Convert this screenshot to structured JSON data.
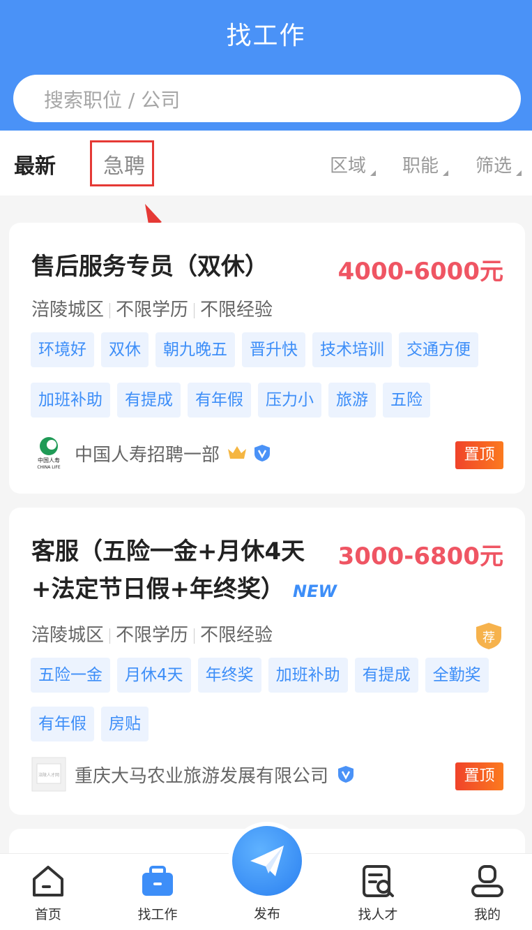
{
  "header": {
    "title": "找工作",
    "search_placeholder": "搜索职位 / 公司"
  },
  "filters": {
    "tab_latest": "最新",
    "tab_urgent": "急聘",
    "area": "区域",
    "function": "职能",
    "filter": "筛选"
  },
  "jobs": [
    {
      "title": "售后服务专员（双休）",
      "salary": "4000-6000元",
      "location": "涪陵城区",
      "education": "不限学历",
      "experience": "不限经验",
      "tags": [
        "环境好",
        "双休",
        "朝九晚五",
        "晋升快",
        "技术培训",
        "交通方便",
        "加班补助",
        "有提成",
        "有年假",
        "压力小",
        "旅游",
        "五险"
      ],
      "company": "中国人寿招聘一部",
      "pin_label": "置顶",
      "logo_text_cn": "中国人寿",
      "logo_text_en": "CHINA LIFE"
    },
    {
      "title_line1": "客服（五险一金+月休4天",
      "title_line2": "+法定节日假+年终奖）",
      "new_badge": "NEW",
      "salary": "3000-6800元",
      "location": "涪陵城区",
      "education": "不限学历",
      "experience": "不限经验",
      "recommend": "荐",
      "tags": [
        "五险一金",
        "月休4天",
        "年终奖",
        "加班补助",
        "有提成",
        "全勤奖",
        "有年假",
        "房贴"
      ],
      "company": "重庆大马农业旅游发展有限公司",
      "pin_label": "置顶",
      "logo_text": "涪陵人才网"
    }
  ],
  "tabbar": {
    "home": "首页",
    "jobs": "找工作",
    "publish": "发布",
    "talent": "找人才",
    "me": "我的"
  },
  "colors": {
    "primary": "#4a92f7",
    "salary": "#ef5563",
    "tag_text": "#3d8ef8",
    "tag_bg": "#ecf3fe",
    "pin": "#f0432a",
    "highlight": "#e53935"
  }
}
